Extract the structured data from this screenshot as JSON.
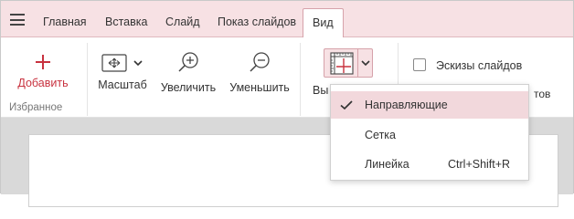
{
  "tabs": [
    {
      "label": "Главная"
    },
    {
      "label": "Вставка"
    },
    {
      "label": "Слайд"
    },
    {
      "label": "Показ слайдов"
    },
    {
      "label": "Вид"
    }
  ],
  "ribbon": {
    "add_label": "Добавить",
    "favorites_group_label": "Избранное",
    "scale_label": "Масштаб",
    "zoom_in_label": "Увеличить",
    "zoom_out_label": "Уменьшить",
    "view_partial_label": "Вы",
    "thumbnails_label": "Эскизы слайдов",
    "partial_right_label": "тов"
  },
  "menu": {
    "items": [
      {
        "label": "Направляющие",
        "shortcut": "",
        "checked": true
      },
      {
        "label": "Сетка",
        "shortcut": "",
        "checked": false
      },
      {
        "label": "Линейка",
        "shortcut": "Ctrl+Shift+R",
        "checked": false
      }
    ]
  },
  "colors": {
    "accent": "#c8323f",
    "tabbar_bg": "#f7e1e4",
    "selected_item_bg": "#f2d8dc"
  },
  "icons": [
    "menu-icon",
    "plus-icon",
    "fit-screen-icon",
    "zoom-in-icon",
    "zoom-out-icon",
    "guides-icon",
    "chevron-down-icon",
    "checkmark-icon"
  ]
}
